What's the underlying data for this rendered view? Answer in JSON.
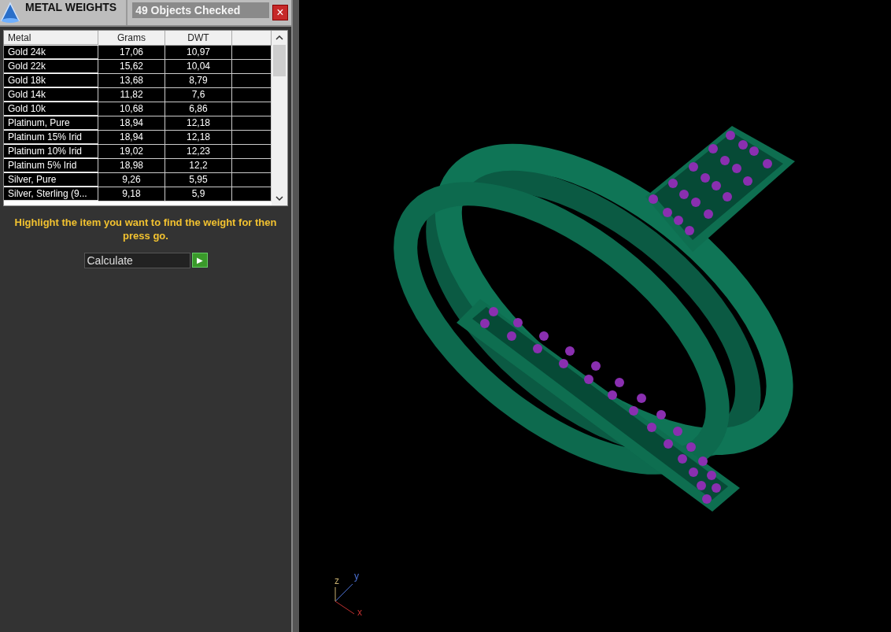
{
  "panel": {
    "title": "METAL WEIGHTS",
    "status": "49 Objects Checked",
    "close": "×"
  },
  "table": {
    "columns": [
      "Metal",
      "Grams",
      "DWT"
    ],
    "rows": [
      {
        "cells": [
          "Gold 24k",
          "17,06",
          "10,97"
        ],
        "selected": true
      },
      {
        "cells": [
          "Gold 22k",
          "15,62",
          "10,04"
        ],
        "selected": true
      },
      {
        "cells": [
          "Gold 18k",
          "13,68",
          "8,79"
        ],
        "selected": true
      },
      {
        "cells": [
          "Gold 14k",
          "11,82",
          "7,6"
        ],
        "selected": true
      },
      {
        "cells": [
          "Gold 10k",
          "10,68",
          "6,86"
        ],
        "selected": true
      },
      {
        "cells": [
          "Platinum, Pure",
          "18,94",
          "12,18"
        ],
        "selected": true
      },
      {
        "cells": [
          "Platinum 15% Irid",
          "18,94",
          "12,18"
        ],
        "selected": true
      },
      {
        "cells": [
          "Platinum 10% Irid",
          "19,02",
          "12,23"
        ],
        "selected": true
      },
      {
        "cells": [
          "Platinum 5% Irid",
          "18,98",
          "12,2"
        ],
        "selected": true
      },
      {
        "cells": [
          "Silver, Pure",
          "9,26",
          "5,95"
        ],
        "selected": true
      },
      {
        "cells": [
          "Silver, Sterling (9...",
          "9,18",
          "5,9"
        ],
        "selected": true
      }
    ]
  },
  "hint": "Highlight the item you want to find the weight for then press go.",
  "action": {
    "value": "Calculate",
    "go": "▶"
  },
  "viewport": {
    "axes": [
      "z",
      "y",
      "x"
    ]
  }
}
